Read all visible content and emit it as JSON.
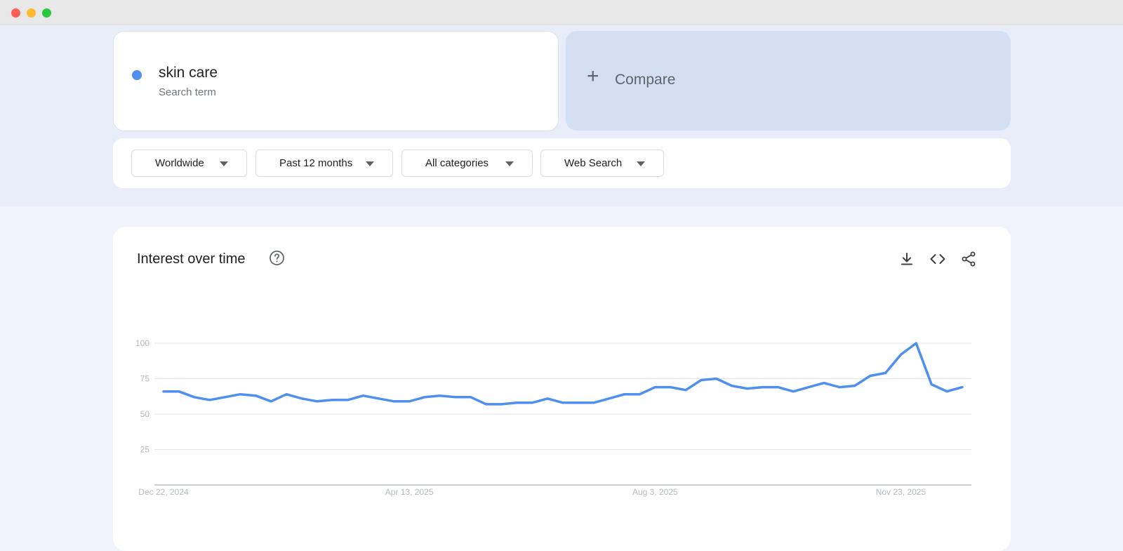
{
  "search": {
    "term": "skin care",
    "term_type": "Search term",
    "term_color": "#4f8ff0",
    "compare_label": "Compare",
    "compare_icon": "plus-icon"
  },
  "filters": [
    {
      "label": "Worldwide"
    },
    {
      "label": "Past 12 months"
    },
    {
      "label": "All categories"
    },
    {
      "label": "Web Search"
    }
  ],
  "panel": {
    "title": "Interest over time",
    "help_icon": "help-circle-icon",
    "actions": [
      "download-icon",
      "embed-code-icon",
      "share-icon"
    ]
  },
  "chart_data": {
    "type": "line",
    "title": "",
    "xlabel": "",
    "ylabel": "",
    "ylim": [
      0,
      100
    ],
    "yticks": [
      25,
      50,
      75,
      100
    ],
    "grid": true,
    "x_tick_labels": [
      "Dec 22, 2024",
      "Apr 13, 2025",
      "Aug 3, 2025",
      "Nov 23, 2025"
    ],
    "x_tick_index": [
      0,
      16,
      32,
      48
    ],
    "series": [
      {
        "name": "skin care",
        "color": "#4f8ff0",
        "values": [
          66,
          66,
          62,
          60,
          62,
          64,
          63,
          59,
          64,
          61,
          59,
          60,
          60,
          63,
          61,
          59,
          59,
          62,
          63,
          62,
          62,
          57,
          57,
          58,
          58,
          61,
          58,
          58,
          58,
          61,
          64,
          64,
          69,
          69,
          67,
          74,
          75,
          70,
          68,
          69,
          69,
          66,
          69,
          72,
          69,
          70,
          77,
          79,
          92,
          100,
          71,
          66,
          69
        ]
      }
    ]
  }
}
